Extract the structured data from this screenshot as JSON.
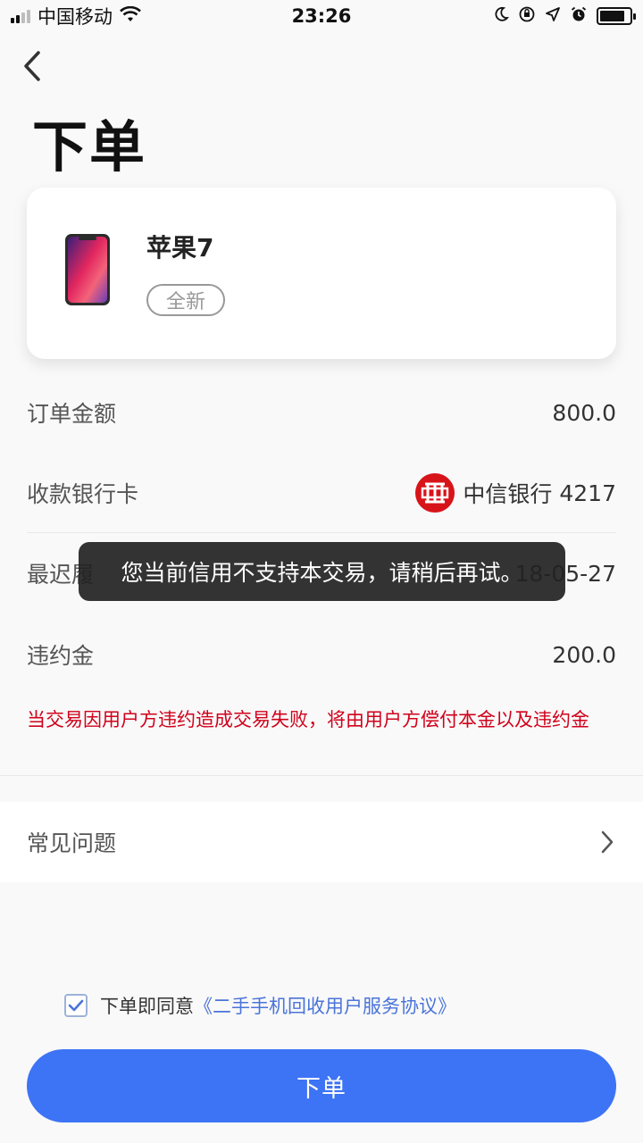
{
  "status_bar": {
    "carrier": "中国移动",
    "time": "23:26",
    "icons": [
      "signal-icon",
      "wifi-icon",
      "moon-icon",
      "orientation-lock-icon",
      "location-icon",
      "alarm-icon",
      "battery-icon"
    ]
  },
  "header": {
    "back_icon": "chevron-left-icon",
    "title": "下单"
  },
  "product": {
    "name": "苹果7",
    "condition": "全新",
    "image_icon": "smartphone-icon"
  },
  "order": {
    "amount_label": "订单金额",
    "amount_value": "800.0",
    "bank_label": "收款银行卡",
    "bank_name": "中信银行",
    "bank_last4": "4217",
    "bank_logo_color": "#d7141a",
    "deadline_label": "最迟履",
    "deadline_value": "18-05-27",
    "penalty_label": "违约金",
    "penalty_value": "200.0"
  },
  "warning_text": "当交易因用户方违约造成交易失败，将由用户方偿付本金以及违约金",
  "faq": {
    "label": "常见问题",
    "chevron_icon": "chevron-right-icon"
  },
  "agreement": {
    "checked": true,
    "prefix": "下单即同意",
    "link": "《二手手机回收用户服务协议》"
  },
  "submit_label": "下单",
  "toast": "您当前信用不支持本交易，请稍后再试。",
  "colors": {
    "accent": "#3d73f5",
    "warning": "#d0021b",
    "link": "#4a74d9"
  }
}
